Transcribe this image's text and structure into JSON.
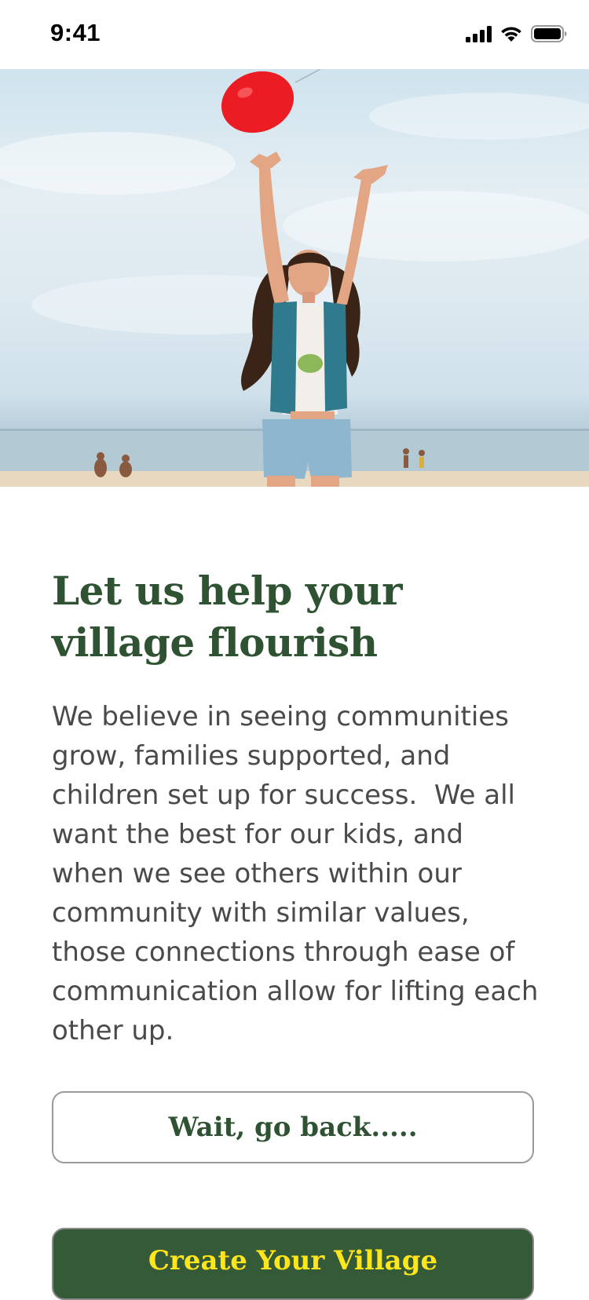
{
  "status_bar": {
    "time": "9:41"
  },
  "hero": {
    "icon": "photo-girl-balloon-beach"
  },
  "main": {
    "headline": "Let us help your village flourish",
    "body": "We believe in seeing communities grow, families supported, and children set up for success.  We all want the best for our kids, and when we see others within our community with similar values, those connections through ease of communication allow for lifting each other up."
  },
  "actions": {
    "back_label": "Wait, go back.....",
    "create_label": "Create Your Village"
  },
  "colors": {
    "brand_green": "#355a38",
    "heading_green": "#2f5233",
    "accent_yellow": "#ffe61a"
  }
}
